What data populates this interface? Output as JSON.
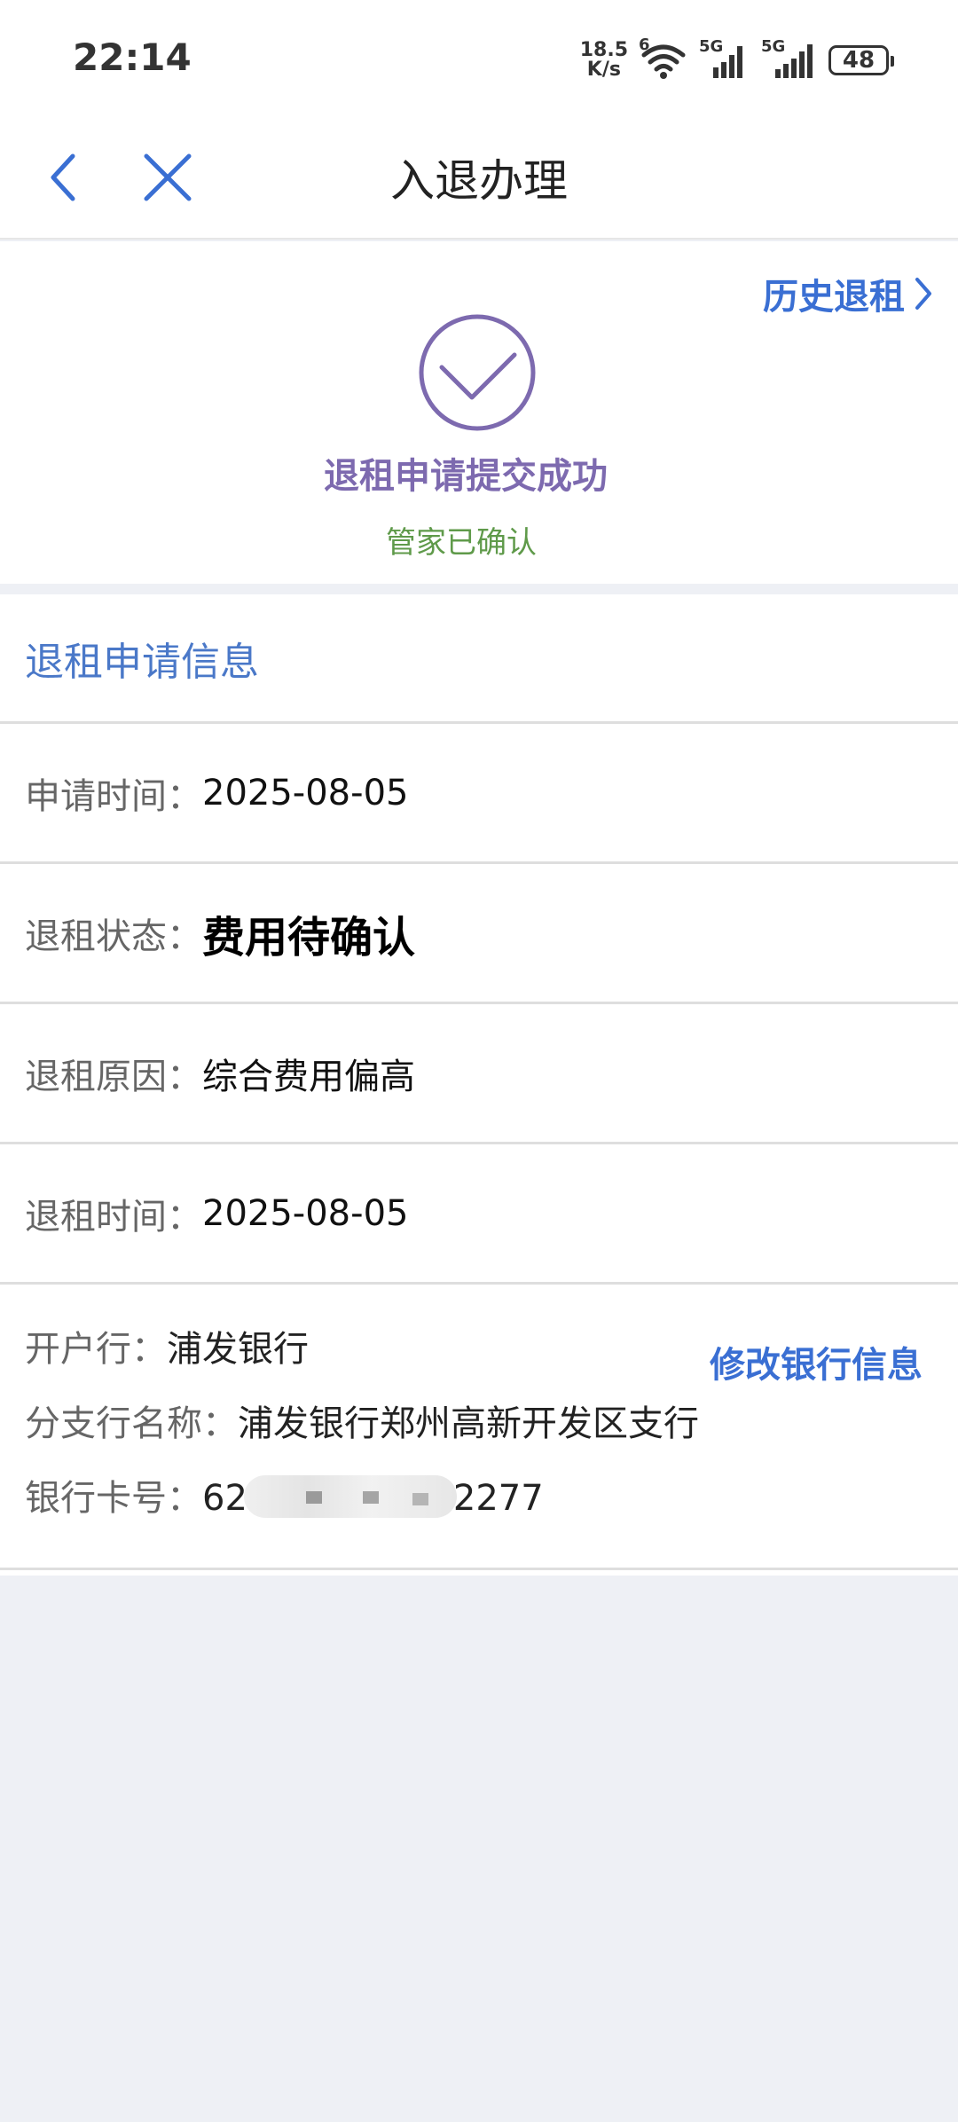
{
  "status_bar": {
    "time": "22:14",
    "net_speed_value": "18.5",
    "net_speed_unit": "K/s",
    "wifi_badge": "6",
    "sim1_label": "5G",
    "sim2_label": "5G",
    "battery": "48"
  },
  "nav": {
    "title": "入退办理"
  },
  "result": {
    "history_link": "历史退租",
    "title": "退租申请提交成功",
    "subtitle": "管家已确认"
  },
  "info": {
    "section_title": "退租申请信息",
    "rows": [
      {
        "label": "申请时间：",
        "value": "2025-08-05"
      },
      {
        "label": "退租状态：",
        "value": "费用待确认"
      },
      {
        "label": "退租原因：",
        "value": "综合费用偏高"
      },
      {
        "label": "退租时间：",
        "value": "2025-08-05"
      }
    ]
  },
  "bank": {
    "bank_label": "开户行：",
    "bank_value": "浦发银行",
    "edit_label": "修改银行信息",
    "branch_label": "分支行名称：",
    "branch_value": "浦发银行郑州高新开发区支行",
    "card_label": "银行卡号：",
    "card_prefix": "62",
    "card_suffix": "2277"
  },
  "colors": {
    "accent_blue": "#3a6fd3",
    "success_purple": "#7d6aaf",
    "confirm_green": "#5f9a4a",
    "section_title_blue": "#4a78c8"
  }
}
